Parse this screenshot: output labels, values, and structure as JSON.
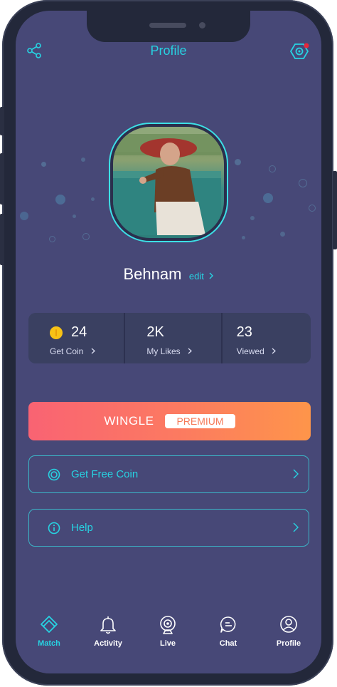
{
  "header": {
    "title": "Profile"
  },
  "profile": {
    "name": "Behnam",
    "edit_label": "edit"
  },
  "stats": [
    {
      "value": "24",
      "label": "Get Coin"
    },
    {
      "value": "2K",
      "label": "My Likes"
    },
    {
      "value": "23",
      "label": "Viewed"
    }
  ],
  "premium": {
    "brand": "WINGLE",
    "badge": "PREMIUM"
  },
  "menu": [
    {
      "label": "Get Free Coin",
      "icon": "coin-ring-icon"
    },
    {
      "label": "Help",
      "icon": "info-icon"
    }
  ],
  "tabbar": {
    "items": [
      {
        "label": "Match",
        "icon": "match-icon",
        "active": true
      },
      {
        "label": "Activity",
        "icon": "bell-icon",
        "active": false
      },
      {
        "label": "Live",
        "icon": "webcam-icon",
        "active": false
      },
      {
        "label": "Chat",
        "icon": "chat-icon",
        "active": false
      },
      {
        "label": "Profile",
        "icon": "user-icon",
        "active": false
      }
    ]
  },
  "colors": {
    "accent": "#27d3e2",
    "background": "#474877",
    "card": "#3a4061",
    "premium_start": "#f96373",
    "premium_end": "#fe954a",
    "notification_dot": "#e5283a"
  }
}
